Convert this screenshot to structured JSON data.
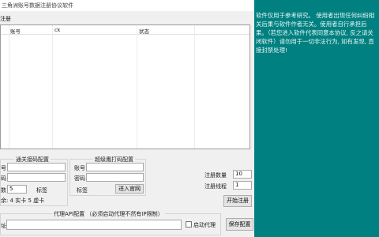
{
  "window": {
    "title": "三角洲账号数据注册协议软件"
  },
  "tab": {
    "label": "注册"
  },
  "grid": {
    "columns": [
      "账号",
      "ck",
      "状态"
    ]
  },
  "proxy_ext": {
    "title": "通关接码配置",
    "field_label_1": "号",
    "field_label_2": "码",
    "field_label_3": "数",
    "value_3": "5",
    "tag_label": "标签",
    "status_text": "余: 4 实卡 5 虚卡"
  },
  "captcha": {
    "title": "超级鹰打码配置",
    "account_label": "账号",
    "password_label": "密码",
    "tag_label": "标签",
    "enter_site_button": "进入官网"
  },
  "register": {
    "count_label": "注册数量",
    "count_value": "10",
    "threads_label": "注册线程",
    "threads_value": "1",
    "start_button": "开始注册"
  },
  "proxy_api": {
    "title": "代理API配置 （必须启动代理不然有IP限制）",
    "addr_label": "址",
    "enable_label": "启动代理",
    "save_button": "保存配置"
  },
  "notice": {
    "text": "软件仅用于参考研究。 使用者出现任何纠纷相关后果与软件作者无关。使用者自行承担后果。（若您进入软件代表同意本协议, 反之请关闭软件）请勿用于一切非法行为, 如有发现, 直接封禁处理!"
  },
  "colors": {
    "notice_bg": "#008080",
    "window_bg": "#f0f0f0"
  }
}
